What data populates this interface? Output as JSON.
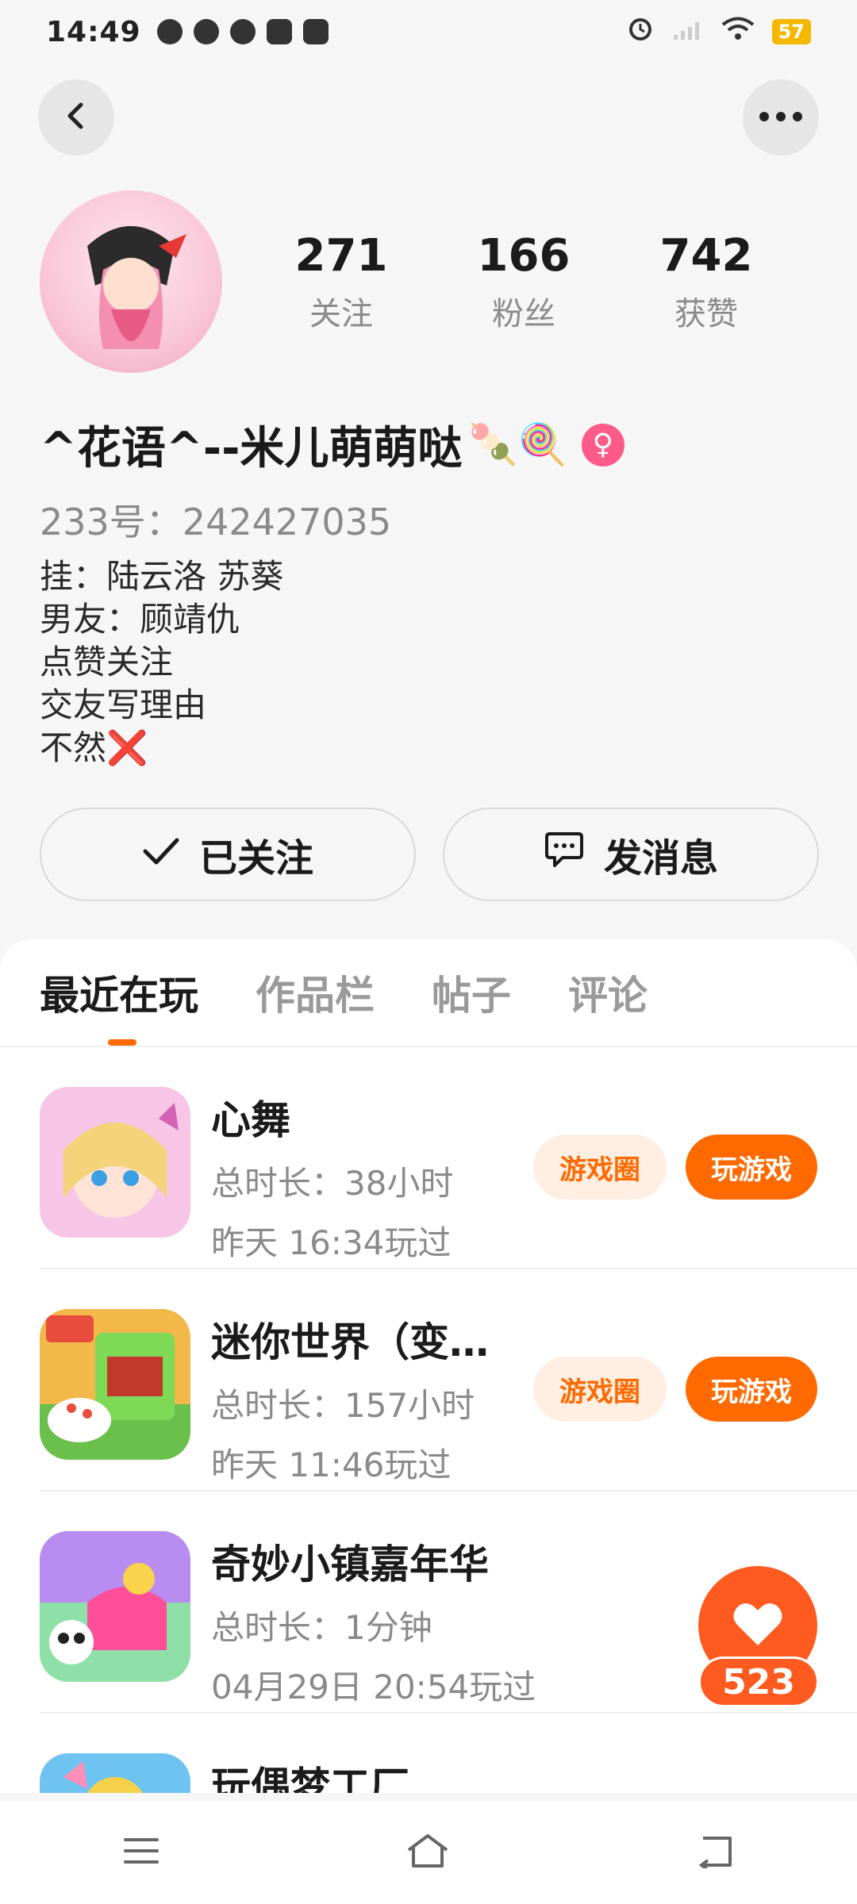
{
  "status": {
    "time": "14:49",
    "battery": "57"
  },
  "profile": {
    "name": "^花语^--米儿萌萌哒",
    "candy": "🍡🍭",
    "gender_symbol": "♀",
    "uid": "233号：242427035",
    "bio": [
      "挂：陆云洛 苏葵",
      "男友：顾靖仇",
      "点赞关注",
      "交友写理由",
      "不然❌"
    ],
    "stats": [
      {
        "value": "271",
        "label": "关注"
      },
      {
        "value": "166",
        "label": "粉丝"
      },
      {
        "value": "742",
        "label": "获赞"
      }
    ]
  },
  "actions": {
    "followed_label": "已关注",
    "message_label": "发消息"
  },
  "tabs": [
    "最近在玩",
    "作品栏",
    "帖子",
    "评论"
  ],
  "games": [
    {
      "title": "心舞",
      "duration": "总时长：38小时",
      "last_played": "昨天 16:34玩过",
      "circle_label": "游戏圈",
      "play_label": "玩游戏"
    },
    {
      "title": "迷你世界（变…",
      "duration": "总时长：157小时",
      "last_played": "昨天 11:46玩过",
      "circle_label": "游戏圈",
      "play_label": "玩游戏"
    },
    {
      "title": "奇妙小镇嘉年华",
      "duration": "总时长：1分钟",
      "last_played": "04月29日 20:54玩过",
      "circle_label": "",
      "play_label": ""
    },
    {
      "title": "玩偶梦工厂",
      "duration": "",
      "last_played": "",
      "circle_label": "",
      "play_label": ""
    }
  ],
  "like": {
    "count": "523"
  },
  "colors": {
    "accent": "#ff6a00",
    "accent_light": "#ffeee2"
  }
}
